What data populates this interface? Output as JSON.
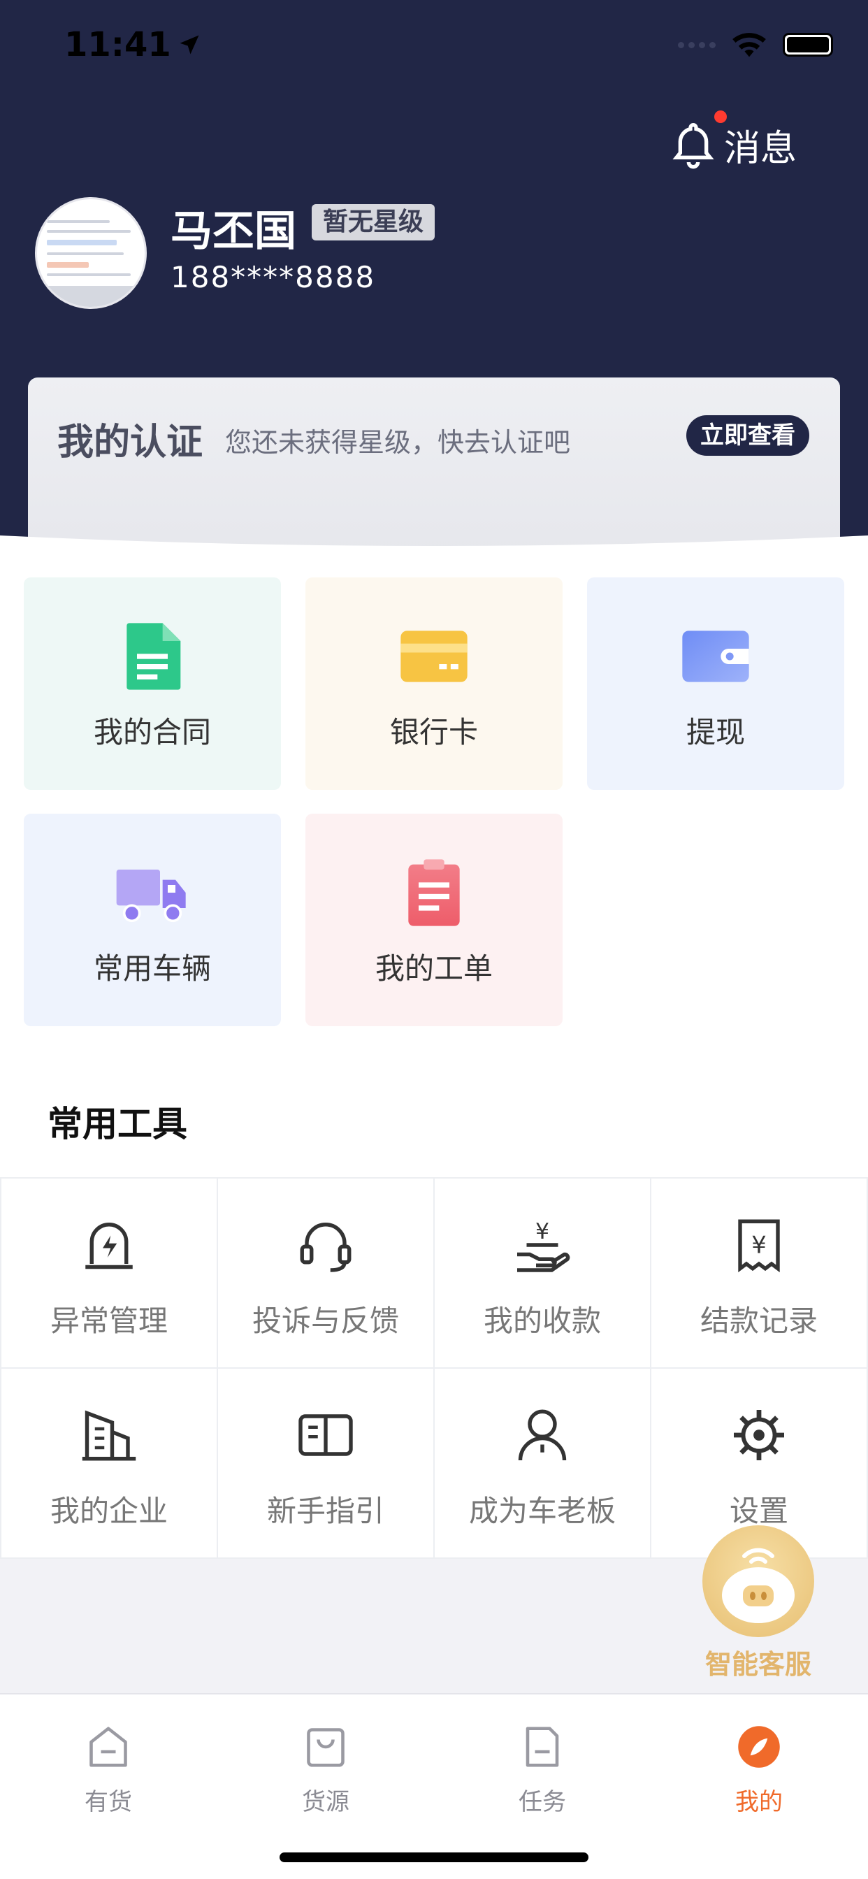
{
  "status_bar": {
    "time": "11:41"
  },
  "header": {
    "message_label": "消息",
    "user_name": "马丕国",
    "star_badge": "暂无星级",
    "phone": "188****8888"
  },
  "certification": {
    "title": "我的认证",
    "subtitle": "您还未获得星级，快去认证吧",
    "button": "立即查看"
  },
  "cards": [
    {
      "label": "我的合同",
      "icon": "contract-icon",
      "bg": "#eef8f6"
    },
    {
      "label": "银行卡",
      "icon": "bank-card-icon",
      "bg": "#fdf8ef"
    },
    {
      "label": "提现",
      "icon": "wallet-icon",
      "bg": "#eef3fd"
    },
    {
      "label": "常用车辆",
      "icon": "truck-icon",
      "bg": "#eef3fd"
    },
    {
      "label": "我的工单",
      "icon": "work-order-icon",
      "bg": "#fdf1f2"
    }
  ],
  "tools_title": "常用工具",
  "tools": [
    {
      "label": "异常管理",
      "icon": "alert-lamp-icon"
    },
    {
      "label": "投诉与反馈",
      "icon": "headset-icon"
    },
    {
      "label": "我的收款",
      "icon": "receive-money-icon"
    },
    {
      "label": "结款记录",
      "icon": "payment-record-icon"
    },
    {
      "label": "我的企业",
      "icon": "building-icon"
    },
    {
      "label": "新手指引",
      "icon": "book-icon"
    },
    {
      "label": "成为车老板",
      "icon": "person-icon"
    },
    {
      "label": "设置",
      "icon": "gear-icon"
    }
  ],
  "assistant": {
    "label": "智能客服"
  },
  "tabbar": [
    {
      "label": "有货",
      "icon": "home-icon",
      "active": false
    },
    {
      "label": "货源",
      "icon": "bag-icon",
      "active": false
    },
    {
      "label": "任务",
      "icon": "task-icon",
      "active": false
    },
    {
      "label": "我的",
      "icon": "compass-icon",
      "active": true
    }
  ],
  "colors": {
    "header_bg": "#212646",
    "accent": "#f06a2a",
    "green": "#2dc88a",
    "gold": "#f7c443",
    "purple": "#8f7bf0",
    "red": "#f0616e"
  }
}
